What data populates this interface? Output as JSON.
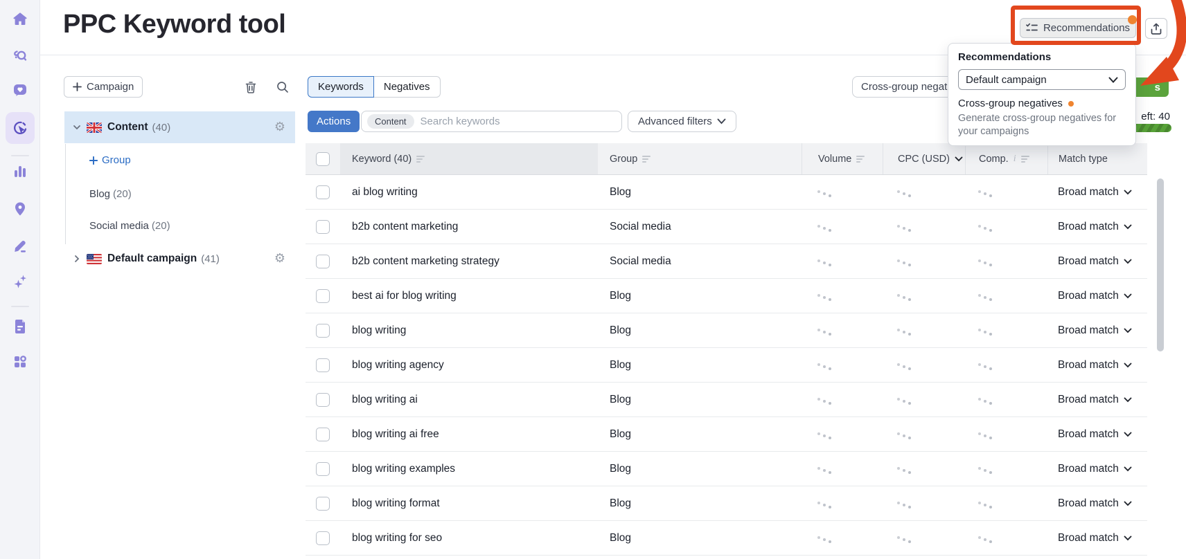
{
  "app": {
    "title": "PPC Keyword tool"
  },
  "colors": {
    "accent_blue": "#4478c8",
    "selected_blue_bg": "#d9e8f7",
    "brand_purple": "#8b83d9",
    "green": "#5ba33c",
    "notification_orange": "#ef8430",
    "annotation_red": "#e2471d"
  },
  "sidebar": {
    "icons": [
      "home-icon",
      "explore-search-icon",
      "feedback-heart-icon",
      "ppc-targeting-icon",
      "analytics-bars-icon",
      "location-pin-icon",
      "edit-pencil-icon",
      "ai-sparkles-icon",
      "report-document-icon",
      "apps-grid-icon"
    ],
    "active_icon": "ppc-targeting-icon"
  },
  "header": {
    "recommendations_button": {
      "label": "Recommendations",
      "icon": "checklist-icon",
      "has_notification_dot": true
    },
    "export_button": {
      "icon": "export-icon"
    }
  },
  "popup": {
    "title": "Recommendations",
    "campaign_select": {
      "value": "Default campaign",
      "icon": "chevron-down-icon"
    },
    "item": {
      "title": "Cross-group negatives",
      "has_notification_dot": true,
      "description": "Generate cross-group negatives for your campaigns"
    }
  },
  "left_panel": {
    "campaign_button": {
      "label": "Campaign",
      "icon": "plus-icon"
    },
    "trash_icon": "trash-icon",
    "search_icon": "search-icon",
    "tree": {
      "content_campaign": {
        "label": "Content",
        "count": "(40)",
        "flag": "uk-flag",
        "expanded": true,
        "gear_icon": "gear-icon"
      },
      "add_group_link": "Group",
      "groups": [
        {
          "label": "Blog",
          "count": "(20)"
        },
        {
          "label": "Social media",
          "count": "(20)"
        }
      ],
      "default_campaign": {
        "label": "Default campaign",
        "count": "(41)",
        "flag": "us-flag",
        "expanded": false,
        "gear_icon": "gear-icon"
      }
    }
  },
  "toolbar": {
    "tabs": [
      {
        "label": "Keywords",
        "active": true
      },
      {
        "label": "Negatives",
        "active": false
      }
    ],
    "actions_button": "Actions",
    "search": {
      "chip": "Content",
      "placeholder": "Search keywords"
    },
    "advanced_filters": "Advanced filters",
    "cross_group_button_visible_text": "Cross-group negat",
    "green_button_visible_text": "s",
    "keywords_left_visible_text": "eft: 40"
  },
  "table": {
    "headers": {
      "keyword": "Keyword (40)",
      "group": "Group",
      "volume": "Volume",
      "cpc": "CPC (USD)",
      "comp": "Comp.",
      "match_type": "Match type"
    },
    "rows": [
      {
        "keyword": "ai blog writing",
        "group": "Blog",
        "match_type": "Broad match"
      },
      {
        "keyword": "b2b content marketing",
        "group": "Social media",
        "match_type": "Broad match"
      },
      {
        "keyword": "b2b content marketing strategy",
        "group": "Social media",
        "match_type": "Broad match"
      },
      {
        "keyword": "best ai for blog writing",
        "group": "Blog",
        "match_type": "Broad match"
      },
      {
        "keyword": "blog writing",
        "group": "Blog",
        "match_type": "Broad match"
      },
      {
        "keyword": "blog writing agency",
        "group": "Blog",
        "match_type": "Broad match"
      },
      {
        "keyword": "blog writing ai",
        "group": "Blog",
        "match_type": "Broad match"
      },
      {
        "keyword": "blog writing ai free",
        "group": "Blog",
        "match_type": "Broad match"
      },
      {
        "keyword": "blog writing examples",
        "group": "Blog",
        "match_type": "Broad match"
      },
      {
        "keyword": "blog writing format",
        "group": "Blog",
        "match_type": "Broad match"
      },
      {
        "keyword": "blog writing for seo",
        "group": "Blog",
        "match_type": "Broad match"
      }
    ]
  }
}
